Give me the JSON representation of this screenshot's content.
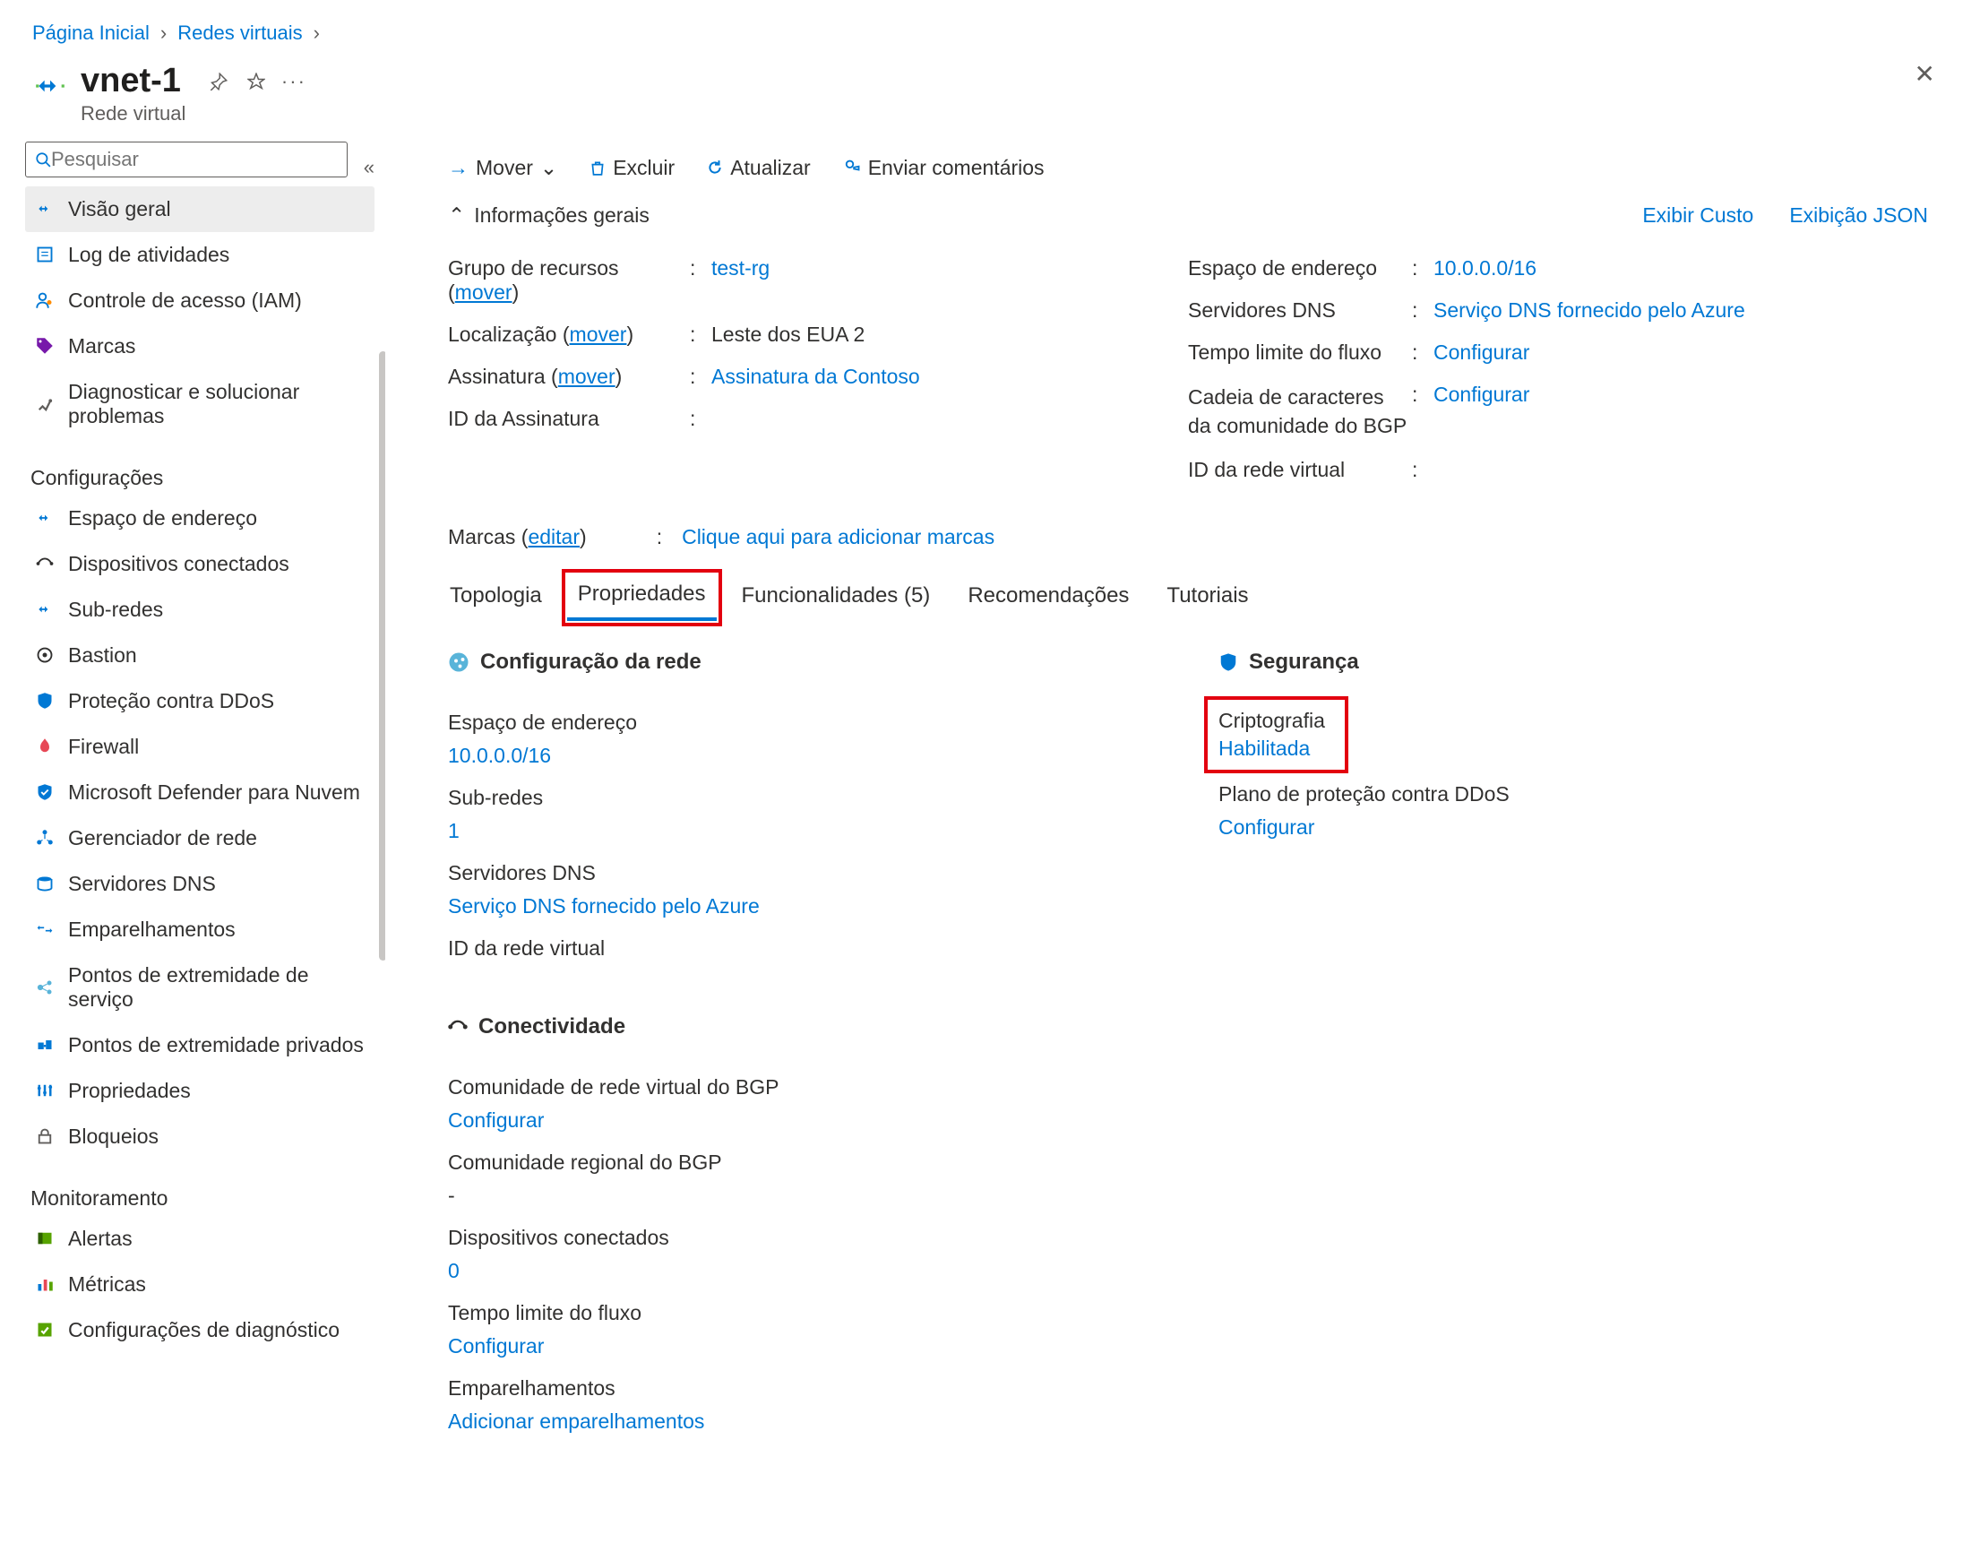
{
  "breadcrumb": {
    "home": "Página Inicial",
    "vnets": "Redes virtuais"
  },
  "header": {
    "title": "vnet-1",
    "subtitle": "Rede virtual"
  },
  "search": {
    "placeholder": "Pesquisar"
  },
  "sidebar": {
    "overview": "Visão geral",
    "activity_log": "Log de atividades",
    "iam": "Controle de acesso (IAM)",
    "tags": "Marcas",
    "diagnose": "Diagnosticar e solucionar problemas",
    "section_settings": "Configurações",
    "address_space": "Espaço de endereço",
    "connected_devices": "Dispositivos conectados",
    "subnets": "Sub-redes",
    "bastion": "Bastion",
    "ddos": "Proteção contra DDoS",
    "firewall": "Firewall",
    "defender": "Microsoft Defender para Nuvem",
    "network_mgr": "Gerenciador de rede",
    "dns_servers": "Servidores DNS",
    "peerings": "Emparelhamentos",
    "svc_endpoints": "Pontos de extremidade de serviço",
    "priv_endpoints": "Pontos de extremidade privados",
    "properties": "Propriedades",
    "locks": "Bloqueios",
    "section_monitoring": "Monitoramento",
    "alerts": "Alertas",
    "metrics": "Métricas",
    "diag_settings": "Configurações de diagnóstico"
  },
  "cmdbar": {
    "move": "Mover",
    "delete": "Excluir",
    "refresh": "Atualizar",
    "feedback": "Enviar comentários"
  },
  "essentials": {
    "toggle_label": "Informações gerais",
    "show_cost": "Exibir Custo",
    "json_view": "Exibição JSON",
    "rg_label": "Grupo de recursos",
    "move_link": "mover",
    "rg_value": "test-rg",
    "location_label": "Localização",
    "location_value": "Leste dos EUA 2",
    "sub_label": "Assinatura",
    "sub_value": "Assinatura da Contoso",
    "subid_label": "ID da Assinatura",
    "addr_label": "Espaço de endereço",
    "addr_value": "10.0.0.0/16",
    "dns_label": "Servidores DNS",
    "dns_value": "Serviço DNS fornecido pelo Azure",
    "flow_label": "Tempo limite do fluxo",
    "configure": "Configurar",
    "bgp_label": "Cadeia de caracteres da comunidade do BGP",
    "vnetid_label": "ID da rede virtual",
    "tags_label": "Marcas",
    "tags_edit": "editar",
    "tags_prompt": "Clique aqui para adicionar marcas"
  },
  "tabs": {
    "topology": "Topologia",
    "properties": "Propriedades",
    "capabilities": "Funcionalidades (5)",
    "recommendations": "Recomendações",
    "tutorials": "Tutoriais"
  },
  "netcfg": {
    "title": "Configuração da rede",
    "addr_label": "Espaço de endereço",
    "addr_value": "10.0.0.0/16",
    "subnets_label": "Sub-redes",
    "subnets_value": "1",
    "dns_label": "Servidores DNS",
    "dns_value": "Serviço DNS fornecido pelo Azure",
    "vnetid_label": "ID da rede virtual"
  },
  "security": {
    "title": "Segurança",
    "crypto_label": "Criptografia",
    "crypto_value": "Habilitada",
    "ddos_label": "Plano de proteção contra DDoS",
    "configure": "Configurar"
  },
  "connectivity": {
    "title": "Conectividade",
    "bgp_vnet_label": "Comunidade de rede virtual do BGP",
    "configure": "Configurar",
    "bgp_regional_label": "Comunidade regional do BGP",
    "bgp_regional_value": "-",
    "devices_label": "Dispositivos conectados",
    "devices_value": "0",
    "flow_label": "Tempo limite do fluxo",
    "peerings_label": "Emparelhamentos",
    "add_peerings": "Adicionar emparelhamentos"
  }
}
